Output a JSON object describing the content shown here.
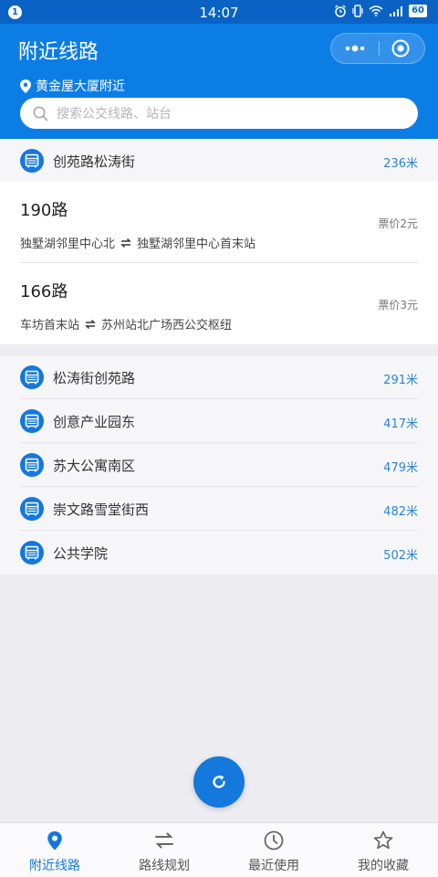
{
  "status_bar": {
    "notification_count": "1",
    "time": "14:07",
    "battery": "60"
  },
  "header": {
    "title": "附近线路",
    "location": "黄金屋大厦附近",
    "search_placeholder": "搜索公交线路、站台"
  },
  "current_station": {
    "name": "创苑路松涛街",
    "distance": "236米"
  },
  "routes": [
    {
      "name": "190路",
      "from": "独墅湖邻里中心北",
      "to": "独墅湖邻里中心首末站",
      "fare": "票价2元"
    },
    {
      "name": "166路",
      "from": "车坊首末站",
      "to": "苏州站北广场西公交枢纽",
      "fare": "票价3元"
    }
  ],
  "nearby_stations": [
    {
      "name": "松涛街创苑路",
      "distance": "291米"
    },
    {
      "name": "创意产业园东",
      "distance": "417米"
    },
    {
      "name": "苏大公寓南区",
      "distance": "479米"
    },
    {
      "name": "崇文路雪堂街西",
      "distance": "482米"
    },
    {
      "name": "公共学院",
      "distance": "502米"
    }
  ],
  "tabs": [
    {
      "label": "附近线路",
      "icon": "location-pin-icon",
      "active": true
    },
    {
      "label": "路线规划",
      "icon": "route-arrows-icon",
      "active": false
    },
    {
      "label": "最近使用",
      "icon": "clock-icon",
      "active": false
    },
    {
      "label": "我的收藏",
      "icon": "star-icon",
      "active": false
    }
  ],
  "colors": {
    "primary": "#0d7de6",
    "accent_text": "#2c83d8",
    "status_bar": "#0a63c4"
  }
}
